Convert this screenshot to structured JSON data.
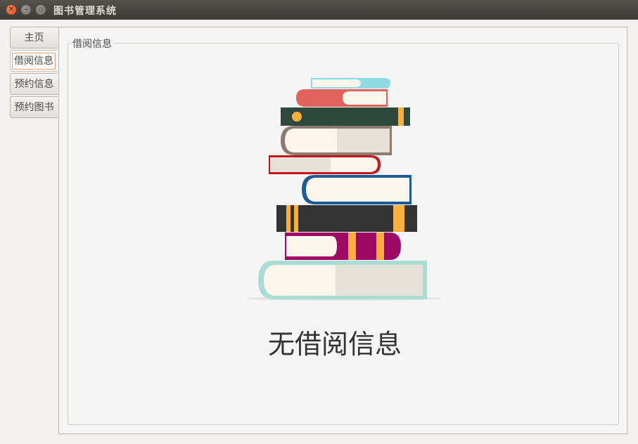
{
  "window": {
    "title": "图书管理系统"
  },
  "tabs": [
    {
      "label": "主页",
      "active": false
    },
    {
      "label": "借阅信息",
      "active": true
    },
    {
      "label": "预约信息",
      "active": false
    },
    {
      "label": "预约图书",
      "active": false
    }
  ],
  "group": {
    "title": "借阅信息"
  },
  "empty": {
    "message": "无借阅信息",
    "illustration_icon": "book-stack-icon"
  },
  "colors": {
    "accent": "#df4a16",
    "titlebar": "#3c3b37",
    "text": "#333333"
  }
}
